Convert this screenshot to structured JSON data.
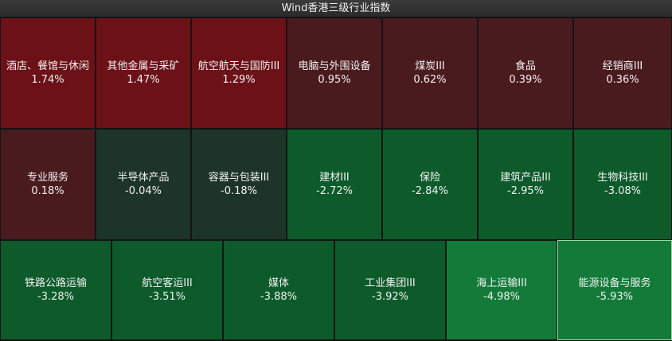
{
  "title": "Wind香港三级行业指数",
  "tiles": [
    {
      "name": "酒店、餐馆与休闲",
      "pct": "1.74%",
      "color": "#6b1117"
    },
    {
      "name": "其他金属与采矿",
      "pct": "1.47%",
      "color": "#6b1117"
    },
    {
      "name": "航空航天与国防III",
      "pct": "1.29%",
      "color": "#6b1117"
    },
    {
      "name": "电脑与外围设备",
      "pct": "0.95%",
      "color": "#4a1b1e"
    },
    {
      "name": "煤炭III",
      "pct": "0.62%",
      "color": "#4a1b1e"
    },
    {
      "name": "食品",
      "pct": "0.39%",
      "color": "#4a1b1e"
    },
    {
      "name": "经销商III",
      "pct": "0.36%",
      "color": "#4a1b1e"
    },
    {
      "name": "专业服务",
      "pct": "0.18%",
      "color": "#4a1b1e"
    },
    {
      "name": "半导体产品",
      "pct": "-0.04%",
      "color": "#1d3429"
    },
    {
      "name": "容器与包装III",
      "pct": "-0.18%",
      "color": "#1d3429"
    },
    {
      "name": "建材III",
      "pct": "-2.72%",
      "color": "#0d5a2b"
    },
    {
      "name": "保险",
      "pct": "-2.84%",
      "color": "#0d5a2b"
    },
    {
      "name": "建筑产品III",
      "pct": "-2.95%",
      "color": "#0d5a2b"
    },
    {
      "name": "生物科技III",
      "pct": "-3.08%",
      "color": "#0d5a2b"
    },
    {
      "name": "铁路公路运输",
      "pct": "-3.28%",
      "color": "#0d5a2b"
    },
    {
      "name": "航空客运III",
      "pct": "-3.51%",
      "color": "#0d5a2b"
    },
    {
      "name": "媒体",
      "pct": "-3.88%",
      "color": "#0d5a2b"
    },
    {
      "name": "工业集团III",
      "pct": "-3.92%",
      "color": "#0d5a2b"
    },
    {
      "name": "海上运输III",
      "pct": "-4.98%",
      "color": "#137a39"
    },
    {
      "name": "能源设备与服务",
      "pct": "-5.93%",
      "color": "#137a39"
    }
  ]
}
